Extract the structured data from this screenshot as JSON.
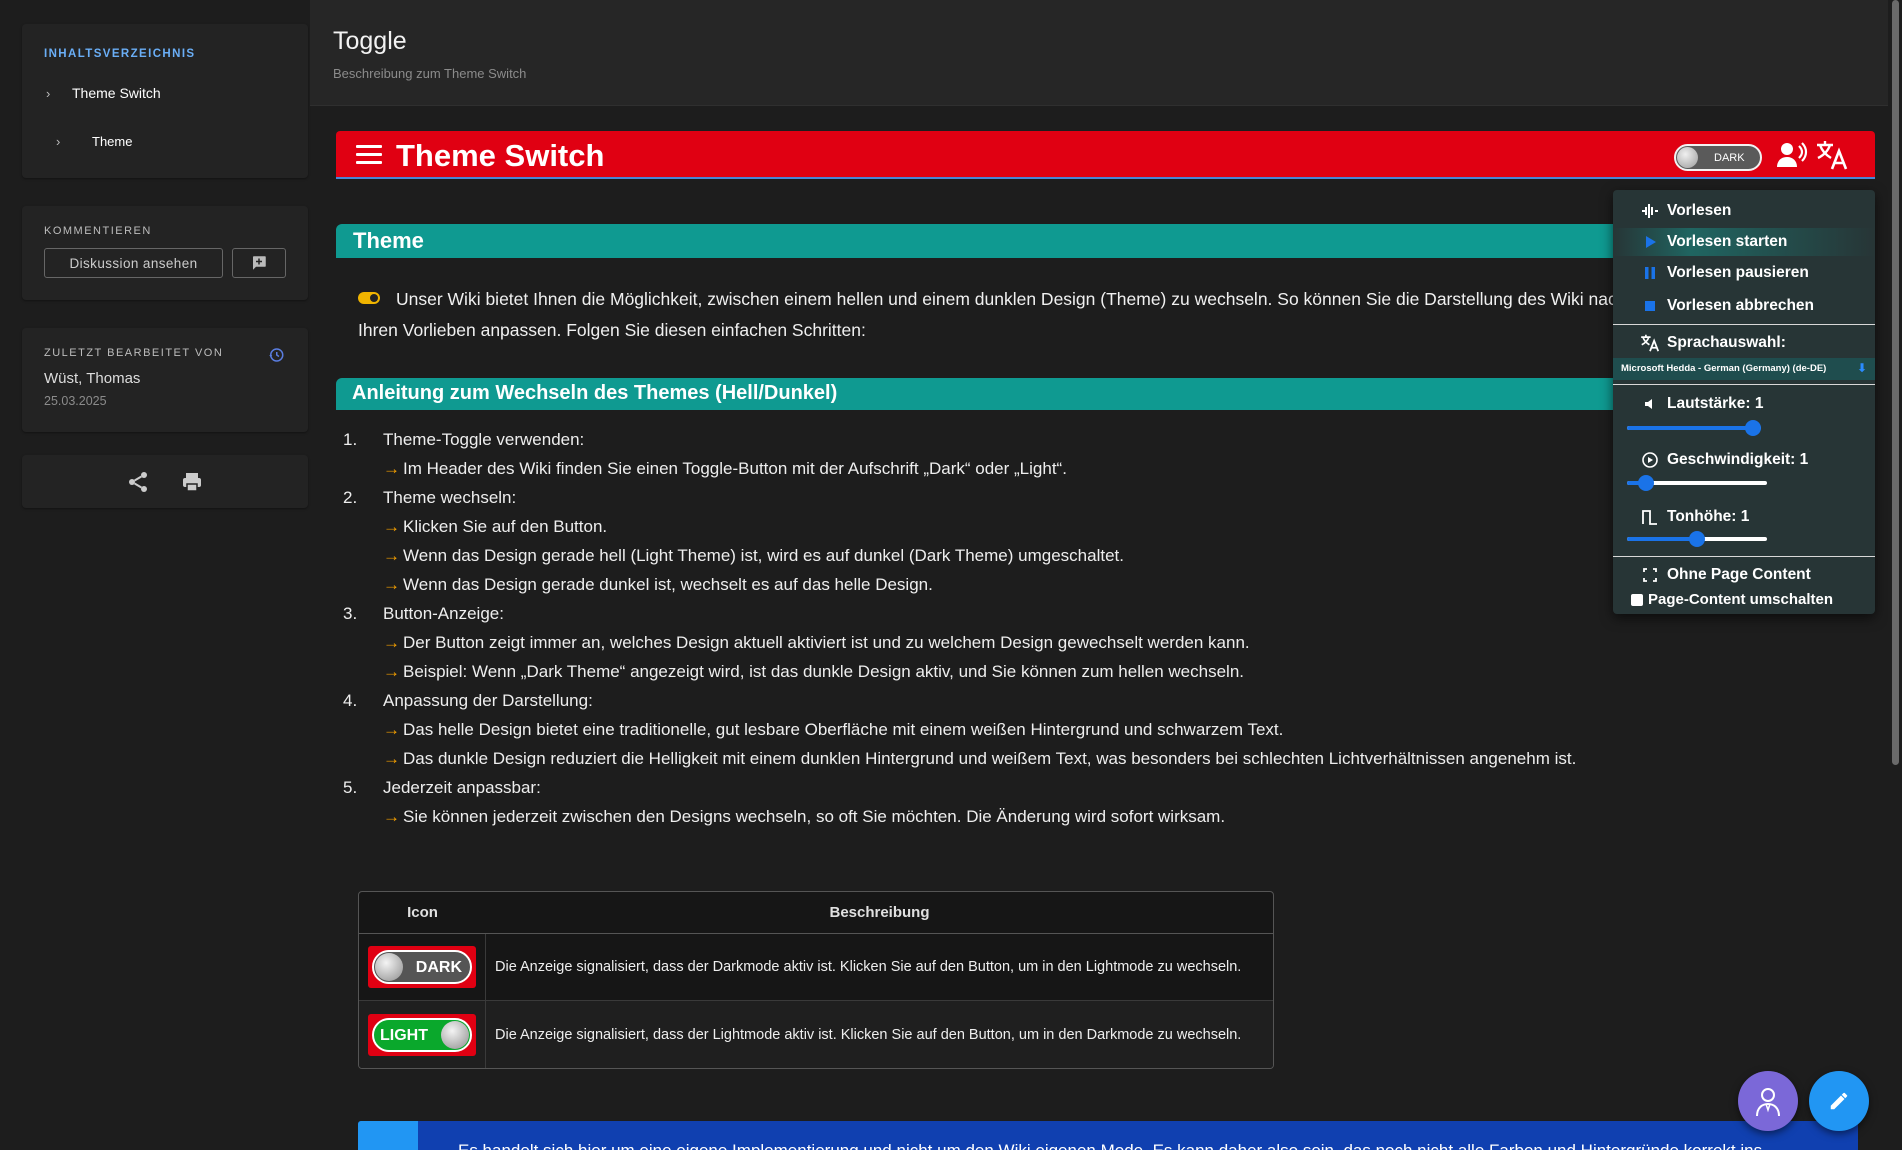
{
  "toc": {
    "heading": "INHALTSVERZEICHNIS",
    "items": [
      {
        "label": "Theme Switch"
      },
      {
        "label": "Theme"
      }
    ]
  },
  "comments": {
    "heading": "KOMMENTIEREN",
    "discussion_label": "Diskussion ansehen"
  },
  "last_edited": {
    "heading": "ZULETZT BEARBEITET VON",
    "author": "Wüst, Thomas",
    "date": "25.03.2025"
  },
  "page": {
    "title": "Toggle",
    "subtitle": "Beschreibung zum Theme Switch"
  },
  "banner": {
    "title": "Theme Switch",
    "toggle_label": "DARK"
  },
  "sections": {
    "theme_title": "Theme",
    "intro": "Unser Wiki bietet Ihnen die Möglichkeit, zwischen einem hellen und einem dunklen Design (Theme) zu wechseln. So können Sie die Darstellung des Wiki nach Ihren Vorlieben anpassen. Folgen Sie diesen einfachen Schritten:",
    "guide_title": "Anleitung zum Wechseln des Themes (Hell/Dunkel)"
  },
  "steps": [
    {
      "num": "1.",
      "title": "Theme-Toggle verwenden:",
      "subs": [
        "Im Header des Wiki finden Sie einen Toggle-Button mit der Aufschrift „Dark“ oder „Light“."
      ]
    },
    {
      "num": "2.",
      "title": "Theme wechseln:",
      "subs": [
        "Klicken Sie auf den Button.",
        "Wenn das Design gerade hell (Light Theme) ist, wird es auf dunkel (Dark Theme) umgeschaltet.",
        "Wenn das Design gerade dunkel ist, wechselt es auf das helle Design."
      ]
    },
    {
      "num": "3.",
      "title": "Button-Anzeige:",
      "subs": [
        "Der Button zeigt immer an, welches Design aktuell aktiviert ist und zu welchem Design gewechselt werden kann.",
        "Beispiel: Wenn „Dark Theme“ angezeigt wird, ist das dunkle Design aktiv, und Sie können zum hellen wechseln."
      ]
    },
    {
      "num": "4.",
      "title": "Anpassung der Darstellung:",
      "subs": [
        "Das helle Design bietet eine traditionelle, gut lesbare Oberfläche mit einem weißen Hintergrund und schwarzem Text.",
        "Das dunkle Design reduziert die Helligkeit mit einem dunklen Hintergrund und weißem Text, was besonders bei schlechten Lichtverhältnissen angenehm ist."
      ]
    },
    {
      "num": "5.",
      "title": "Jederzeit anpassbar:",
      "subs": [
        "Sie können jederzeit zwischen den Designs wechseln, so oft Sie möchten. Die Änderung wird sofort wirksam."
      ]
    }
  ],
  "table": {
    "col_icon": "Icon",
    "col_desc": "Beschreibung",
    "rows": [
      {
        "toggle": "DARK",
        "desc": "Die Anzeige signalisiert, dass der Darkmode aktiv ist. Klicken Sie auf den Button, um in den Lightmode zu wechseln."
      },
      {
        "toggle": "LIGHT",
        "desc": "Die Anzeige signalisiert, dass der Lightmode aktiv ist. Klicken Sie auf den Button, um in den Darkmode zu wechseln."
      }
    ]
  },
  "note": {
    "text": "Es handelt sich hier um eine eigene Implementierung und nicht um den Wiki eigenen Mode. Es kann daher also sein, das noch nicht alle Farben und Hintergründe korrekt ins"
  },
  "tts_menu": {
    "read": "Vorlesen",
    "start": "Vorlesen starten",
    "pause": "Vorlesen pausieren",
    "stop": "Vorlesen abbrechen",
    "language": "Sprachauswahl:",
    "voice": "Microsoft Hedda - German (Germany) (de-DE)",
    "volume": "Lautstärke: 1",
    "speed": "Geschwindigkeit: 1",
    "pitch": "Tonhöhe: 1",
    "no_content": "Ohne Page Content",
    "toggle_content": "Page-Content umschalten",
    "volume_level": 1.0,
    "speed_level": 0.1,
    "pitch_level": 0.5
  },
  "colors": {
    "accent_red": "#e00012",
    "section_teal": "#0f9a91",
    "arrow_orange": "#f5a000",
    "link_blue": "#6aaef6"
  }
}
